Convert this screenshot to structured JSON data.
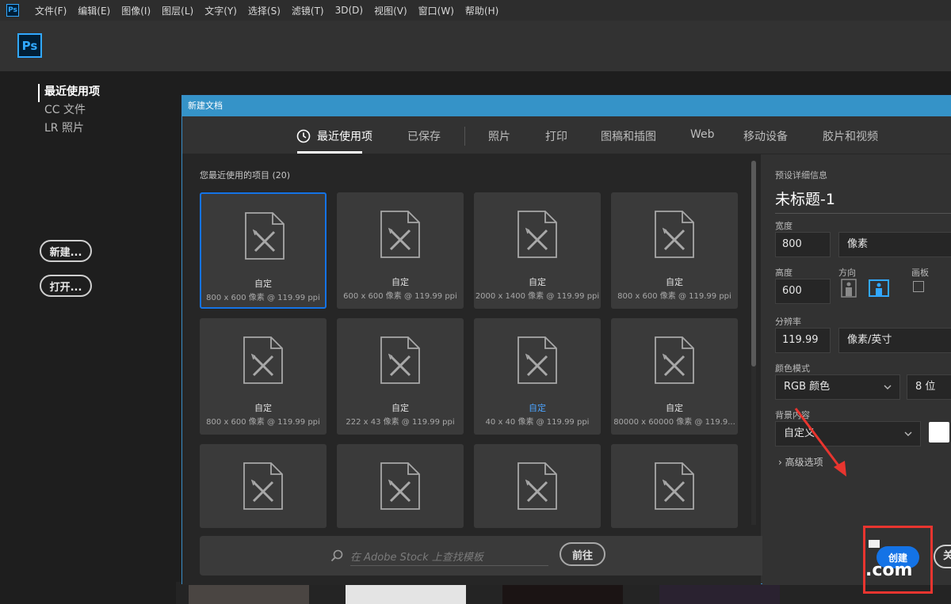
{
  "menubar": {
    "logo": "Ps",
    "items": [
      "文件(F)",
      "编辑(E)",
      "图像(I)",
      "图层(L)",
      "文字(Y)",
      "选择(S)",
      "滤镜(T)",
      "3D(D)",
      "视图(V)",
      "窗口(W)",
      "帮助(H)"
    ]
  },
  "home": {
    "logo": "Ps",
    "nav": [
      "最近使用项",
      "CC 文件",
      "LR 照片"
    ],
    "new_button": "新建...",
    "open_button": "打开..."
  },
  "dialog": {
    "title": "新建文档",
    "tabs": [
      "最近使用项",
      "已保存",
      "照片",
      "打印",
      "图稿和插图",
      "Web",
      "移动设备",
      "胶片和视频"
    ],
    "recent_label": "您最近使用的项目",
    "recent_count": "(20)",
    "cards": [
      {
        "name": "自定",
        "size": "800 x 600 像素 @ 119.99 ppi"
      },
      {
        "name": "自定",
        "size": "600 x 600 像素 @ 119.99 ppi"
      },
      {
        "name": "自定",
        "size": "2000 x 1400 像素 @ 119.99 ppi"
      },
      {
        "name": "自定",
        "size": "800 x 600 像素 @ 119.99 ppi"
      },
      {
        "name": "自定",
        "size": "800 x 600 像素 @ 119.99 ppi"
      },
      {
        "name": "自定",
        "size": "222 x 43 像素 @ 119.99 ppi"
      },
      {
        "name": "自定",
        "size": "40 x 40 像素 @ 119.99 ppi"
      },
      {
        "name": "自定",
        "size": "80000 x 60000 像素 @ 119.9..."
      },
      {
        "name": "",
        "size": ""
      },
      {
        "name": "",
        "size": ""
      },
      {
        "name": "",
        "size": ""
      },
      {
        "name": "",
        "size": ""
      }
    ],
    "search_placeholder": "在 Adobe Stock 上查找模板",
    "go_button": "前往"
  },
  "panel": {
    "section_label": "预设详细信息",
    "doc_title": "未标题-1",
    "width_label": "宽度",
    "width_value": "800",
    "width_unit": "像素",
    "height_label": "高度",
    "height_value": "600",
    "orientation_label": "方向",
    "artboard_label": "画板",
    "resolution_label": "分辨率",
    "resolution_value": "119.99",
    "resolution_unit": "像素/英寸",
    "color_mode_label": "颜色模式",
    "color_mode_value": "RGB 颜色",
    "bit_depth": "8 位",
    "background_label": "背景内容",
    "background_value": "自定义",
    "background_color": "#ffffff",
    "advanced": "高级选项"
  },
  "actions": {
    "create": "创建",
    "close": "关"
  },
  "watermark": ".com",
  "colors": {
    "accent": "#1473e6",
    "title_bar": "#3593c8",
    "highlight_red": "#e8352f"
  }
}
